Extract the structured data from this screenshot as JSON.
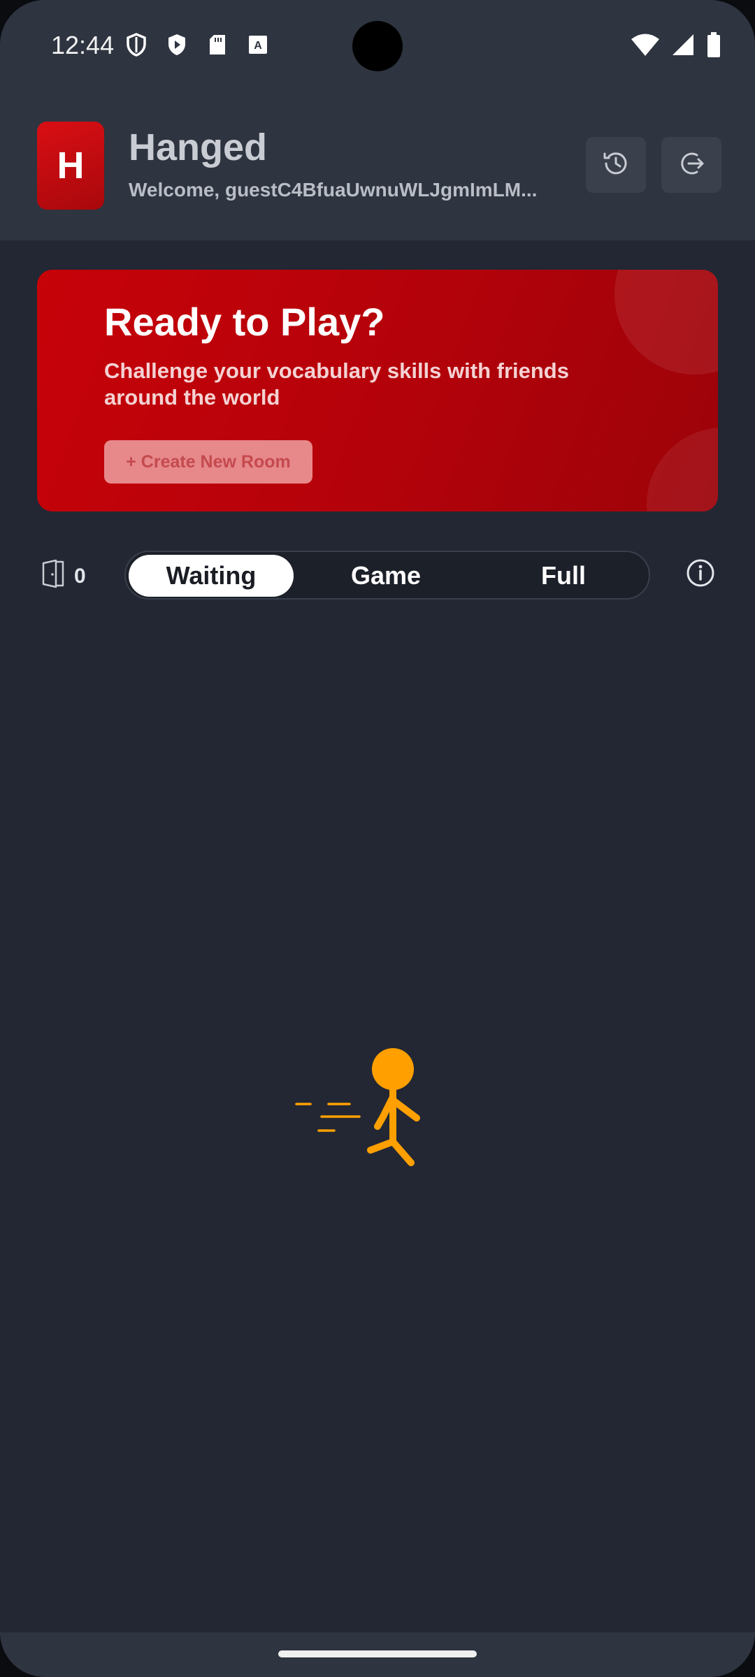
{
  "status_bar": {
    "time": "12:44",
    "left_icons": [
      "shield-outline-icon",
      "play-protect-icon",
      "sd-card-icon",
      "keyboard-a-icon"
    ],
    "right_icons": [
      "wifi-icon",
      "cell-signal-icon",
      "battery-icon"
    ]
  },
  "header": {
    "logo_letter": "H",
    "title": "Hanged",
    "welcome": "Welcome, guestC4BfuaUwnuWLJgmImLM...",
    "actions": [
      "history-icon",
      "logout-icon"
    ]
  },
  "hero": {
    "title": "Ready to Play?",
    "subtitle": "Challenge your vocabulary skills with friends around the world",
    "create_button": "+ Create New Room"
  },
  "filters": {
    "room_count": "0",
    "tabs": [
      {
        "label": "Waiting",
        "active": true
      },
      {
        "label": "Game",
        "active": false
      },
      {
        "label": "Full",
        "active": false
      }
    ]
  },
  "colors": {
    "accent_red": "#c70209",
    "figure_orange": "#ffa000",
    "background": "#222733",
    "header_bg": "#2e3440"
  }
}
